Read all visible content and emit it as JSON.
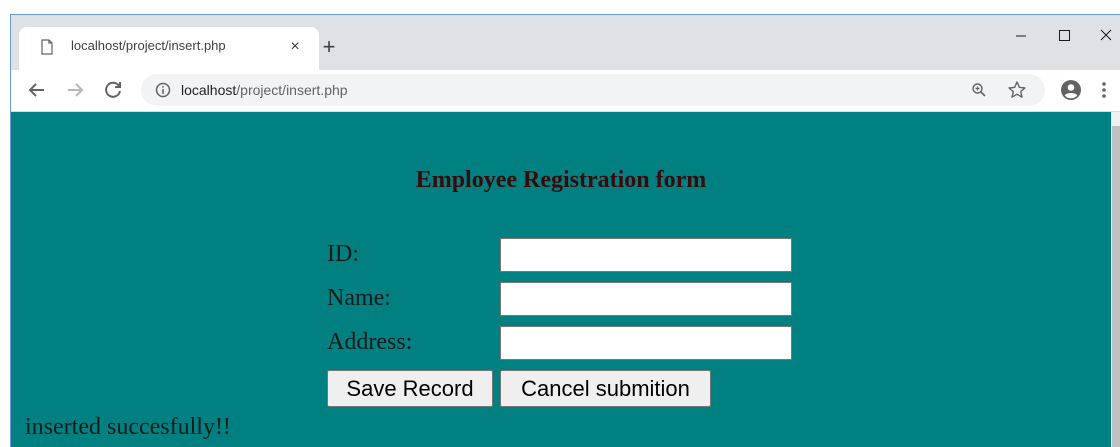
{
  "browser": {
    "tab": {
      "title": "localhost/project/insert.php",
      "close_label": "×"
    },
    "new_tab_label": "+",
    "address_bar": {
      "host": "localhost",
      "path": "/project/insert.php"
    }
  },
  "page": {
    "background": "#008080",
    "title": "Employee Registration form",
    "form": {
      "fields": [
        {
          "label": "ID:",
          "value": ""
        },
        {
          "label": "Name:",
          "value": ""
        },
        {
          "label": "Address:",
          "value": ""
        }
      ],
      "save_label": "Save Record",
      "cancel_label": "Cancel submition"
    },
    "status_message": "inserted succesfully!!"
  },
  "icons": {
    "tab": "page-icon",
    "back": "arrow-left-icon",
    "forward": "arrow-right-icon",
    "reload": "reload-icon",
    "info": "info-icon",
    "zoom": "zoom-icon",
    "bookmark": "star-icon",
    "profile": "profile-icon",
    "menu": "more-vert-icon"
  }
}
